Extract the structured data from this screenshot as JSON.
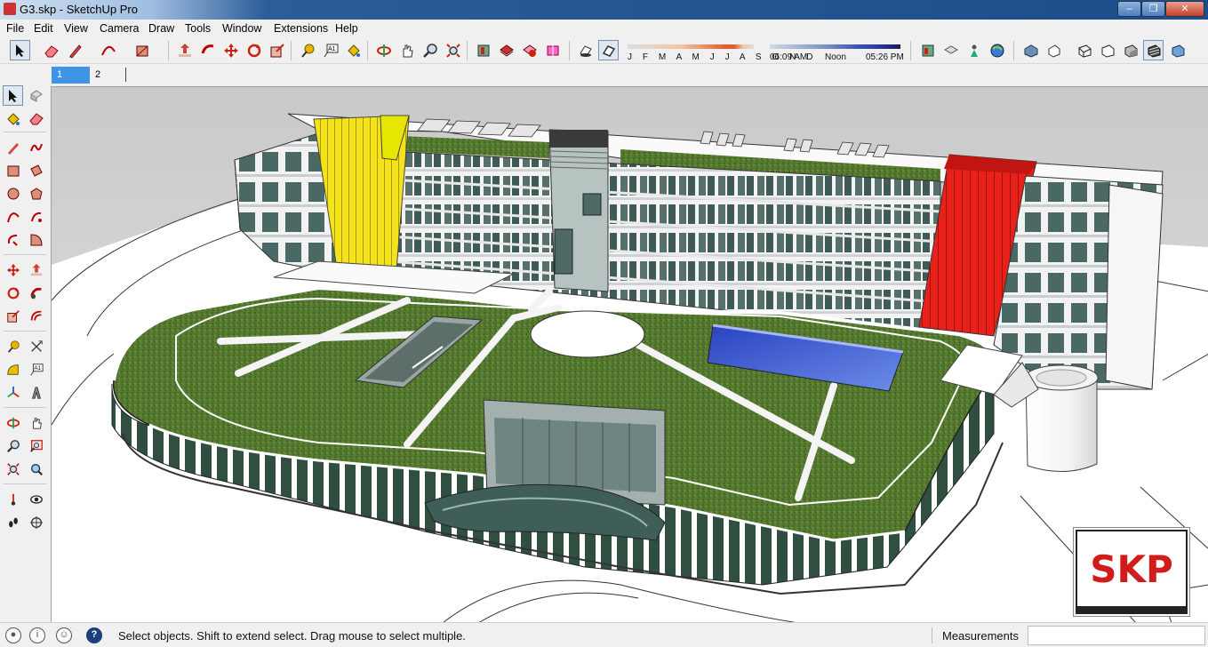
{
  "window": {
    "title": "G3.skp - SketchUp Pro",
    "controls": [
      "minimize",
      "maximize",
      "close"
    ]
  },
  "menu": [
    "File",
    "Edit",
    "View",
    "Camera",
    "Draw",
    "Tools",
    "Window",
    "Extensions",
    "Help"
  ],
  "shadows": {
    "months": "J F M A M J J A S O N D",
    "time_start": "06:09 AM",
    "time_mid": "Noon",
    "time_end": "05:26 PM"
  },
  "scenes": [
    {
      "label": "1",
      "active": true
    },
    {
      "label": "2",
      "active": false
    }
  ],
  "toolbar_icons": [
    "select-icon",
    "eraser-icon",
    "pencil-icon",
    "arc-icon",
    "rectangle-icon",
    "push-pull-icon",
    "follow-me-icon",
    "move-icon",
    "rotate-icon",
    "scale-icon",
    "tape-measure-icon",
    "text-icon",
    "paint-bucket-icon",
    "orbit-icon",
    "pan-icon",
    "zoom-icon",
    "zoom-extents-icon",
    "warehouse-icon",
    "share-model-icon",
    "components-icon",
    "extension-icon",
    "shadows-toggle-icon",
    "fog-icon",
    "iso-view-icon",
    "top-view-icon",
    "front-view-icon",
    "right-view-icon",
    "back-view-icon",
    "xray-icon",
    "wireframe-icon",
    "hidden-line-icon",
    "shaded-icon",
    "shaded-texture-icon",
    "monochrome-icon"
  ],
  "palette_icons": [
    "select-icon",
    "component-icon",
    "paint-bucket-icon",
    "eraser-icon",
    "line-icon",
    "freehand-icon",
    "rectangle-icon",
    "rotated-rectangle-icon",
    "circle-icon",
    "polygon-icon",
    "arc-icon",
    "pie-icon",
    "two-point-arc-icon",
    "three-point-arc-icon",
    "move-icon",
    "push-pull-icon",
    "rotate-icon",
    "follow-me-icon",
    "scale-icon",
    "offset-icon",
    "tape-measure-icon",
    "dimension-icon",
    "protractor-icon",
    "text-icon",
    "axes-icon",
    "3d-text-icon",
    "orbit-icon",
    "pan-icon",
    "zoom-icon",
    "zoom-window-icon",
    "zoom-extents-icon",
    "previous-view-icon",
    "position-camera-icon",
    "look-around-icon",
    "walk-icon",
    "section-plane-icon"
  ],
  "badge": {
    "text": "SKP"
  },
  "status": {
    "message": "Select objects. Shift to extend select. Drag mouse to select multiple.",
    "measurements_label": "Measurements",
    "measurements_value": ""
  },
  "colors": {
    "accent_tab": "#3e95e6",
    "lawn": "#55772e",
    "glass": "#4f6f6a",
    "yellow_core": "#f4e21b",
    "red_core": "#e8221a",
    "pool": "#3050c8",
    "badge_red": "#d11c1c"
  }
}
